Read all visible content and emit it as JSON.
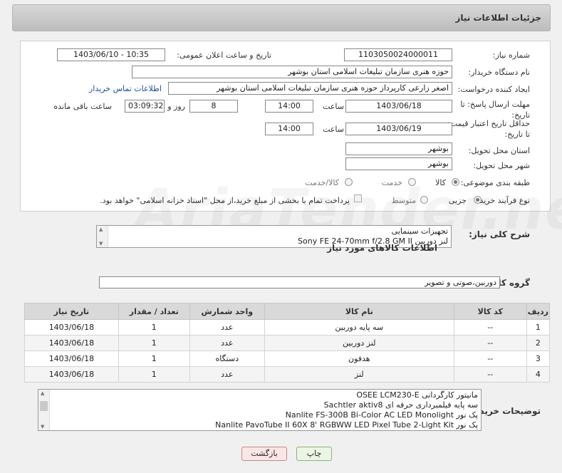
{
  "header": {
    "title": "جزئیات اطلاعات نیاز"
  },
  "form": {
    "need_number_label": "شماره نیاز:",
    "need_number": "1103050024000011",
    "announce_label": "تاریخ و ساعت اعلان عمومی:",
    "announce_value": "1403/06/10 - 10:35",
    "buyer_org_label": "نام دستگاه خریدار:",
    "buyer_org": "حوزه هنری سازمان تبلیغات اسلامی استان بوشهر",
    "creator_label": "ایجاد کننده درخواست:",
    "creator": "اصغر زارعی کارپرداز حوزه هنری سازمان تبلیغات اسلامی استان بوشهر",
    "contact_link": "اطلاعات تماس خریدار",
    "reply_deadline_label": "مهلت ارسال پاسخ: تا تاریخ:",
    "reply_date": "1403/06/18",
    "time_label": "ساعت",
    "reply_time": "14:00",
    "days_value": "8",
    "days_label": "روز و",
    "remaining_time": "03:09:32",
    "remaining_label": "ساعت باقی مانده",
    "price_validity_label": "حداقل تاریخ اعتبار قیمت: تا تاریخ:",
    "price_date": "1403/06/19",
    "price_time": "14:00",
    "province_label": "استان محل تحویل:",
    "province": "بوشهر",
    "city_label": "شهر محل تحویل:",
    "city": "بوشهر",
    "category_label": "طبقه بندی موضوعی:",
    "category_options": [
      "کالا",
      "خدمت",
      "کالا/خدمت"
    ],
    "process_label": "نوع فرآیند خرید :",
    "process_options": [
      "جزیی",
      "متوسط"
    ],
    "payment_note": "پرداخت تمام یا بخشی از مبلغ خرید،از محل \"اسناد خزانه اسلامی\" خواهد بود."
  },
  "summary": {
    "label": "شرح کلی نیاز:",
    "lines": [
      "تجهیزات سینمایی",
      "لنز دوربین    Sony FE 24-70mm f/2.8 GM II"
    ]
  },
  "goods_section_title": "اطلاعات کالاهای مورد نیاز",
  "goods_group_label": "گروه کالا:",
  "goods_group": "دوربین،صوتی و تصویر",
  "table": {
    "headers": [
      "ردیف",
      "کد کالا",
      "نام کالا",
      "واحد شمارش",
      "تعداد / مقدار",
      "تاریخ نیاز"
    ],
    "rows": [
      [
        "1",
        "--",
        "سه پایه دوربین",
        "عدد",
        "1",
        "1403/06/18"
      ],
      [
        "2",
        "--",
        "لنز دوربین",
        "عدد",
        "1",
        "1403/06/18"
      ],
      [
        "3",
        "--",
        "هدفون",
        "دستگاه",
        "1",
        "1403/06/18"
      ],
      [
        "4",
        "--",
        "لنز",
        "عدد",
        "1",
        "1403/06/18"
      ]
    ]
  },
  "buyer_notes": {
    "label": "توضیحات خریدار:",
    "lines": [
      "مانیتور کارگردانی  OSEE LCM230-E",
      "سه پایه فیلمبرداری حرفه ای  Sachtler aktiv8",
      "پک نور     Nanlite FS-300B Bi-Color AC LED Monolight",
      "پک نور     Nanlite PavoTube II 60X 8' RGBWW LED Pixel Tube 2-Light Kit"
    ]
  },
  "buttons": {
    "print": "چاپ",
    "back": "بازگشت"
  },
  "watermark": "AriaTender.net"
}
